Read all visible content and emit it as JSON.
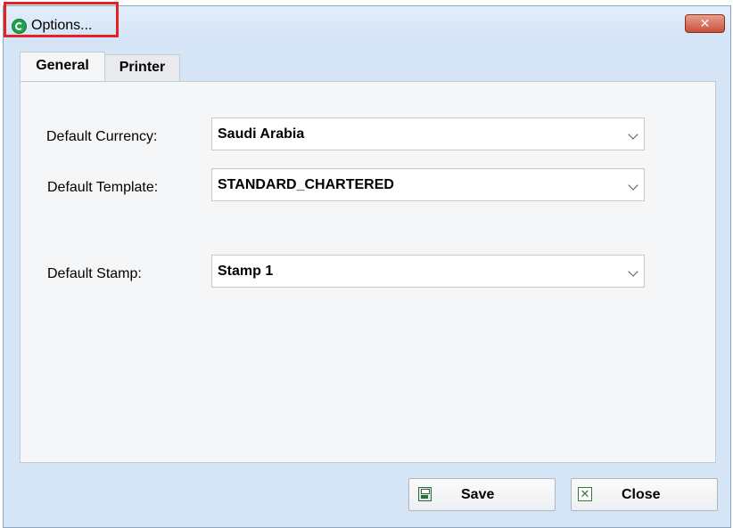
{
  "window": {
    "title": "Options...",
    "close_glyph": "✕"
  },
  "tabs": [
    {
      "label": "General",
      "selected": true
    },
    {
      "label": "Printer",
      "selected": false
    }
  ],
  "form": {
    "currency": {
      "label": "Default Currency:",
      "value": "Saudi Arabia"
    },
    "template": {
      "label": "Default Template:",
      "value": "STANDARD_CHARTERED"
    },
    "stamp": {
      "label": "Default Stamp:",
      "value": "Stamp 1"
    }
  },
  "buttons": {
    "save_label": "Save",
    "close_label": "Close",
    "close_icon_glyph": "✕"
  },
  "colors": {
    "window_bg": "#d5e5f6",
    "panel_bg": "#f5f6f7",
    "highlight": "#e32226",
    "accent_green": "#1fa24a"
  }
}
